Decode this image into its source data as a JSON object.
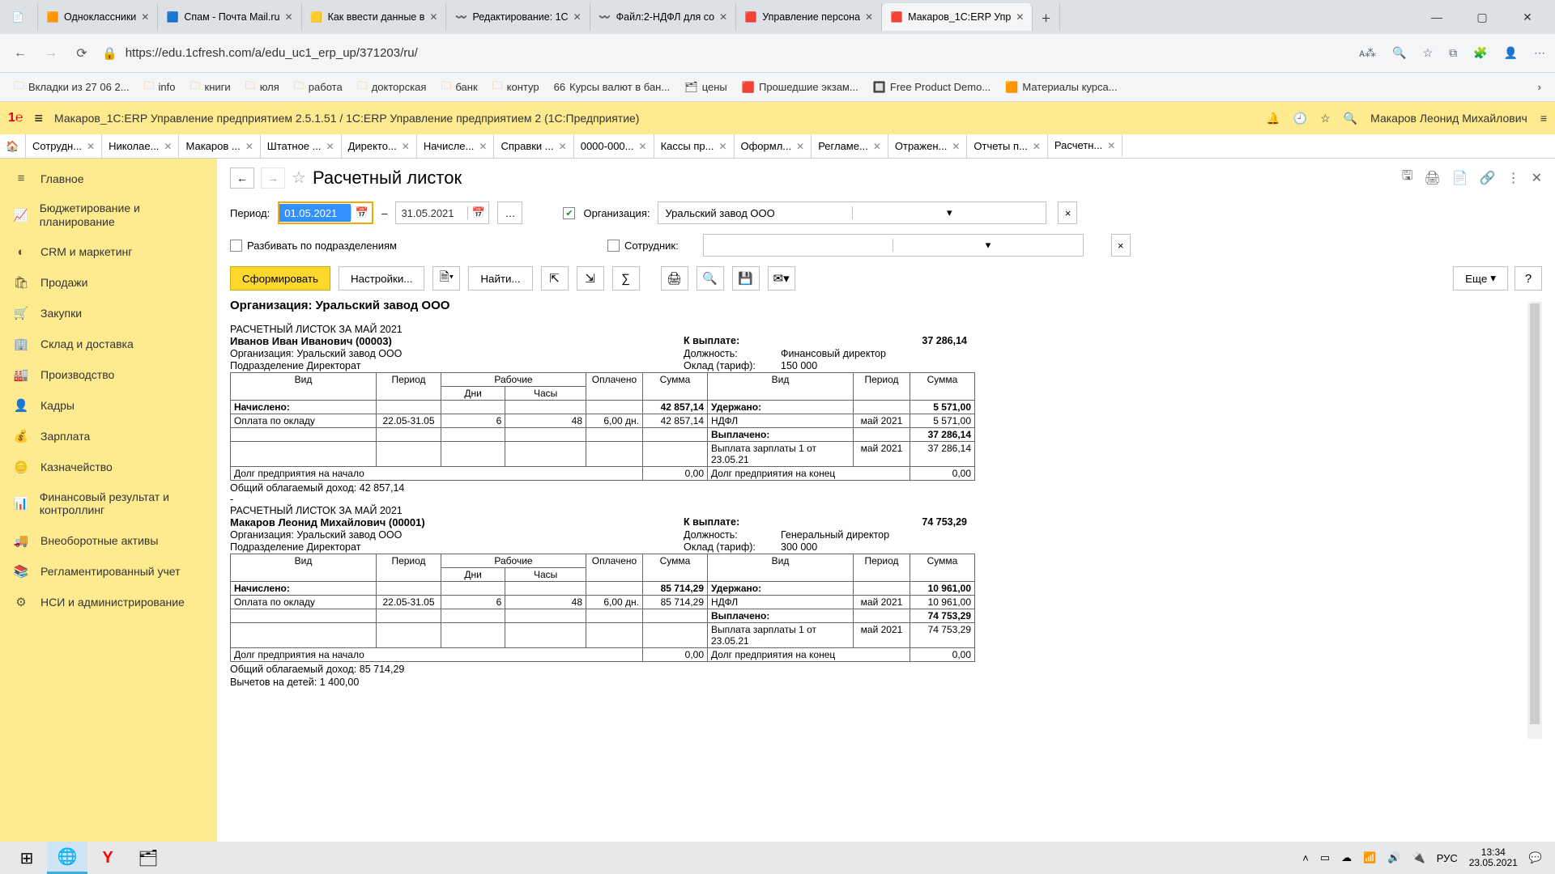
{
  "browser": {
    "tabs": [
      {
        "title": "",
        "icon": "📄",
        "closeable": false
      },
      {
        "title": "Одноклассники",
        "icon": "🟧"
      },
      {
        "title": "Спам - Почта Mail.ru",
        "icon": "🟦"
      },
      {
        "title": "Как ввести данные в",
        "icon": "🟨"
      },
      {
        "title": "Редактирование: 1С",
        "icon": "〰️"
      },
      {
        "title": "Файл:2-НДФЛ для со",
        "icon": "〰️"
      },
      {
        "title": "Управление персона",
        "icon": "🟥"
      },
      {
        "title": "Макаров_1С:ERP Упр",
        "icon": "🟥",
        "active": true
      }
    ],
    "newtab": "＋",
    "window_min": "—",
    "window_max": "▢",
    "window_close": "✕",
    "url": "https://edu.1cfresh.com/a/edu_uc1_erp_up/371203/ru/",
    "bookmarks": [
      "Вкладки из 27 06 2...",
      "info",
      "книги",
      "юля",
      "работа",
      "докторская",
      "банк",
      "контур"
    ],
    "bk_extra": [
      {
        "label": "Курсы валют в бан...",
        "icon": "66"
      },
      {
        "label": "цены",
        "icon": "🗂"
      },
      {
        "label": "Прошедшие экзам...",
        "icon": "🟥"
      },
      {
        "label": "Free Product Demo...",
        "icon": "🔲"
      },
      {
        "label": "Материалы курса...",
        "icon": "🟧"
      }
    ]
  },
  "app": {
    "title": "Макаров_1С:ERP Управление предприятием 2.5.1.51 / 1С:ERP Управление предприятием 2   (1С:Предприятие)",
    "user": "Макаров Леонид Михайлович",
    "tabs": [
      "Сотрудн...",
      "Николае...",
      "Макаров ...",
      "Штатное ...",
      "Директо...",
      "Начисле...",
      "Справки ...",
      "0000-000...",
      "Кассы пр...",
      "Оформл...",
      "Регламе...",
      "Отражен...",
      "Отчеты п...",
      "Расчетн..."
    ],
    "active_tab": "Расчетн..."
  },
  "sidebar": {
    "items": [
      {
        "icon": "≡",
        "label": "Главное"
      },
      {
        "icon": "📈",
        "label": "Бюджетирование и планирование",
        "multi": true
      },
      {
        "icon": "◐",
        "label": "CRM и маркетинг"
      },
      {
        "icon": "🛍",
        "label": "Продажи"
      },
      {
        "icon": "🛒",
        "label": "Закупки"
      },
      {
        "icon": "🏢",
        "label": "Склад и доставка"
      },
      {
        "icon": "🏭",
        "label": "Производство"
      },
      {
        "icon": "👤",
        "label": "Кадры"
      },
      {
        "icon": "💰",
        "label": "Зарплата"
      },
      {
        "icon": "🪙",
        "label": "Казначейство"
      },
      {
        "icon": "📊",
        "label": "Финансовый результат и контроллинг",
        "multi": true
      },
      {
        "icon": "🚚",
        "label": "Внеоборотные активы"
      },
      {
        "icon": "📚",
        "label": "Регламентированный учет",
        "multi": true
      },
      {
        "icon": "⚙",
        "label": "НСИ и администрирование",
        "multi": true
      }
    ]
  },
  "page": {
    "title": "Расчетный листок",
    "period_label": "Период:",
    "date_from": "01.05.2021",
    "date_to": "31.05.2021",
    "dash": "–",
    "org_label": "Организация:",
    "org_value": "Уральский завод ООО",
    "split_label": "Разбивать по подразделениям",
    "employee_label": "Сотрудник:",
    "form_btn": "Сформировать",
    "settings_btn": "Настройки...",
    "find_btn": "Найти...",
    "more_btn": "Еще",
    "help": "?"
  },
  "report": {
    "org_line": "Организация: Уральский завод ООО",
    "slips": [
      {
        "period_title": "РАСЧЕТНЫЙ ЛИСТОК ЗА МАЙ 2021",
        "name": "Иванов Иван Иванович (00003)",
        "org": "Организация:    Уральский завод ООО",
        "dept": "Подразделение Директорат",
        "to_pay_label": "К выплате:",
        "to_pay": "37 286,14",
        "position_label": "Должность:",
        "position": "Финансовый директор",
        "rate_label": "Оклад (тариф):",
        "rate": "150 000",
        "accrued_label": "Начислено:",
        "accrued_total": "42 857,14",
        "withheld_label": "Удержано:",
        "withheld_total": "5 571,00",
        "accr_rows": [
          {
            "kind": "Оплата по окладу",
            "period": "22.05-31.05",
            "days": "6",
            "hours": "48",
            "paid": "6,00 дн.",
            "sum": "42 857,14"
          }
        ],
        "wth_rows": [
          {
            "kind": "НДФЛ",
            "period": "май 2021",
            "sum": "5 571,00"
          }
        ],
        "paid_label": "Выплачено:",
        "paid_total": "37 286,14",
        "paid_rows": [
          {
            "kind": "Выплата зарплаты 1 от 23.05.21",
            "period": "май 2021",
            "sum": "37 286,14"
          }
        ],
        "debt_start_label": "Долг предприятия на начало",
        "debt_start": "0,00",
        "debt_end_label": "Долг предприятия на конец",
        "debt_end": "0,00",
        "tax_base": "Общий облагаемый доход: 42 857,14"
      },
      {
        "period_title": "РАСЧЕТНЫЙ ЛИСТОК ЗА МАЙ 2021",
        "name": "Макаров Леонид Михайлович (00001)",
        "org": "Организация:    Уральский завод ООО",
        "dept": "Подразделение Директорат",
        "to_pay_label": "К выплате:",
        "to_pay": "74 753,29",
        "position_label": "Должность:",
        "position": "Генеральный директор",
        "rate_label": "Оклад (тариф):",
        "rate": "300 000",
        "accrued_label": "Начислено:",
        "accrued_total": "85 714,29",
        "withheld_label": "Удержано:",
        "withheld_total": "10 961,00",
        "accr_rows": [
          {
            "kind": "Оплата по окладу",
            "period": "22.05-31.05",
            "days": "6",
            "hours": "48",
            "paid": "6,00 дн.",
            "sum": "85 714,29"
          }
        ],
        "wth_rows": [
          {
            "kind": "НДФЛ",
            "period": "май 2021",
            "sum": "10 961,00"
          }
        ],
        "paid_label": "Выплачено:",
        "paid_total": "74 753,29",
        "paid_rows": [
          {
            "kind": "Выплата зарплаты 1 от 23.05.21",
            "period": "май 2021",
            "sum": "74 753,29"
          }
        ],
        "debt_start_label": "Долг предприятия на начало",
        "debt_start": "0,00",
        "debt_end_label": "Долг предприятия на конец",
        "debt_end": "0,00",
        "tax_base": "Общий облагаемый доход: 85 714,29",
        "deductions": "Вычетов на детей: 1 400,00"
      }
    ],
    "headers": {
      "kind": "Вид",
      "period": "Период",
      "work": "Рабочие",
      "days": "Дни",
      "hours": "Часы",
      "paid": "Оплачено",
      "sum": "Сумма"
    }
  },
  "taskbar": {
    "time": "13:34",
    "date": "23.05.2021",
    "lang": "РУС"
  }
}
